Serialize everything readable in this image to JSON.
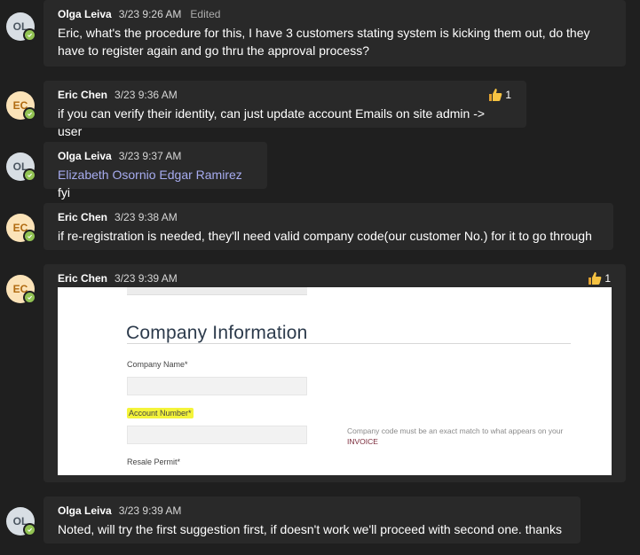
{
  "messages": [
    {
      "avatar_initials": "OL",
      "author": "Olga Leiva",
      "time": "3/23 9:26 AM",
      "edited": "Edited",
      "line1": "Eric, what's the procedure for this, I have 3 customers stating system is kicking them out, do they",
      "line2": "have to register again and go thru the approval process?"
    },
    {
      "avatar_initials": "EC",
      "author": "Eric Chen",
      "time": "3/23 9:36 AM",
      "text": "if you can verify their identity, can just update account Emails on site admin -> user",
      "reaction_count": "1"
    },
    {
      "avatar_initials": "OL",
      "author": "Olga Leiva",
      "time": "3/23 9:37 AM",
      "mention1": "Elizabeth Osornio",
      "mention2": "Edgar Ramirez",
      "text_after": "fyi"
    },
    {
      "avatar_initials": "EC",
      "author": "Eric Chen",
      "time": "3/23 9:38 AM",
      "text": "if re-registration is needed, they'll need valid company code(our customer No.) for it to go through"
    },
    {
      "avatar_initials": "EC",
      "author": "Eric Chen",
      "time": "3/23 9:39 AM",
      "reaction_count": "1",
      "image": {
        "title": "Company Information",
        "company_name_label": "Company Name*",
        "account_number_label": "Account Number*",
        "hint_text": "Company code must be an exact match to what appears on your",
        "hint_invoice": "INVOICE",
        "resale_label": "Resale Permit*"
      }
    },
    {
      "avatar_initials": "OL",
      "author": "Olga Leiva",
      "time": "3/23 9:39 AM",
      "text": "Noted, will try the first suggestion first, if doesn't work we'll proceed with second one. thanks"
    }
  ],
  "colors": {
    "background": "#1f1f1f",
    "bubble": "#292929",
    "presence_available": "#92c353",
    "mention": "#a7acf0",
    "highlight": "#f4f43a"
  }
}
